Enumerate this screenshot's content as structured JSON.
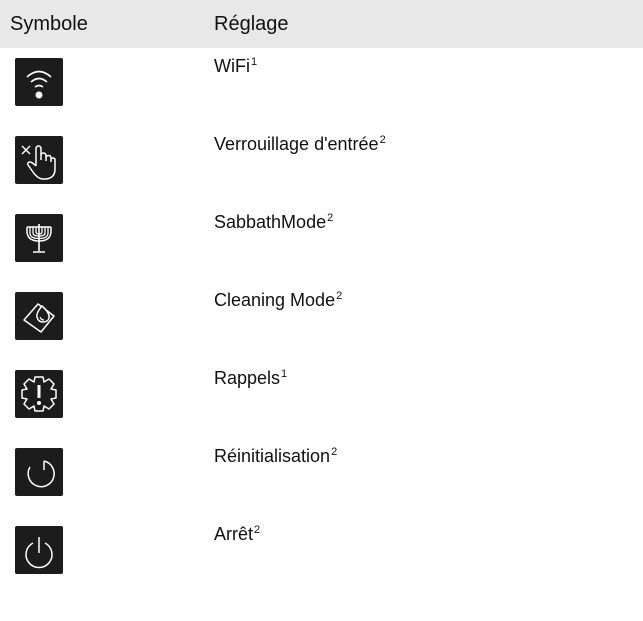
{
  "table": {
    "headers": {
      "symbol": "Symbole",
      "setting": "Réglage"
    },
    "rows": [
      {
        "icon": "wifi-icon",
        "label": "WiFi",
        "note": "1"
      },
      {
        "icon": "input-lock-icon",
        "label": "Verrouillage d'entrée",
        "note": "2"
      },
      {
        "icon": "menorah-icon",
        "label": "SabbathMode",
        "note": "2"
      },
      {
        "icon": "cleaning-mode-icon",
        "label": "Cleaning Mode",
        "note": "2"
      },
      {
        "icon": "reminder-gear-icon",
        "label": "Rappels",
        "note": "1"
      },
      {
        "icon": "reset-icon",
        "label": "Réinitialisation",
        "note": "2"
      },
      {
        "icon": "power-icon",
        "label": "Arrêt",
        "note": "2"
      }
    ]
  },
  "colors": {
    "header_bg": "#e8e8e8",
    "icon_bg": "#1c1c1c",
    "icon_fg": "#ffffff"
  }
}
